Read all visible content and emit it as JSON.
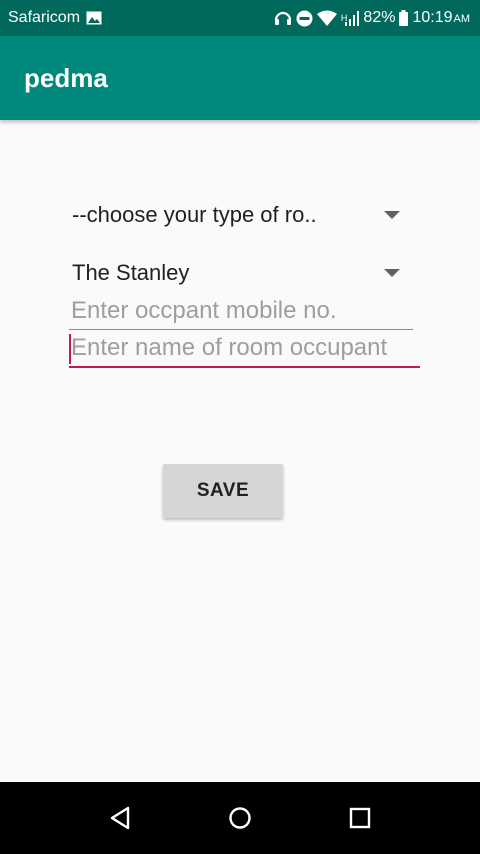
{
  "status_bar": {
    "carrier": "Safaricom",
    "battery": "82%",
    "time": "10:19",
    "time_suffix": "AM",
    "network_label": "H",
    "icons": [
      "image-icon",
      "headphones-icon",
      "do-not-disturb-icon",
      "wifi-icon",
      "signal-icon",
      "battery-icon"
    ]
  },
  "app_bar": {
    "title": "pedma",
    "color": "#00897b"
  },
  "form": {
    "room_type_spinner": {
      "value": "--choose your type of ro.."
    },
    "property_spinner": {
      "value": "The Stanley"
    },
    "mobile_field": {
      "placeholder": "Enter occpant mobile no.",
      "value": ""
    },
    "name_field": {
      "placeholder": "Enter name of room occupant",
      "value": ""
    },
    "save_label": "SAVE",
    "accent_color": "#c2185b"
  },
  "nav_bar": {
    "icons": [
      "back-icon",
      "home-icon",
      "recents-icon"
    ]
  }
}
